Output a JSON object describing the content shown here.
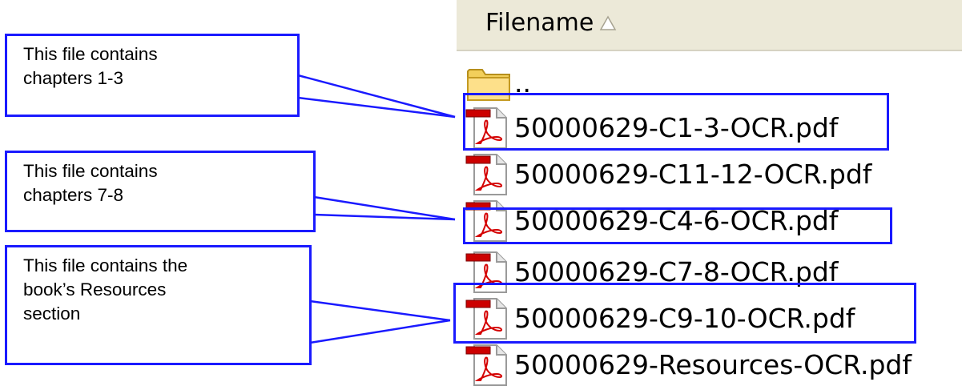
{
  "header": {
    "column_label": "Filename",
    "sort_icon": "sort-up-triangle-icon"
  },
  "parent_entry": {
    "label": "..",
    "icon": "folder-icon"
  },
  "files": [
    {
      "name": "50000629-C1-3-OCR.pdf",
      "icon": "pdf-file-icon"
    },
    {
      "name": "50000629-C11-12-OCR.pdf",
      "icon": "pdf-file-icon"
    },
    {
      "name": "50000629-C4-6-OCR.pdf",
      "icon": "pdf-file-icon"
    },
    {
      "name": "50000629-C7-8-OCR.pdf",
      "icon": "pdf-file-icon"
    },
    {
      "name": "50000629-C9-10-OCR.pdf",
      "icon": "pdf-file-icon"
    },
    {
      "name": "50000629-Resources-OCR.pdf",
      "icon": "pdf-file-icon"
    }
  ],
  "callouts": [
    {
      "lines": [
        "This file contains",
        "chapters 1-3"
      ]
    },
    {
      "lines": [
        "This file contains",
        "chapters 7-8"
      ]
    },
    {
      "lines": [
        "This file contains the",
        "book’s Resources",
        "section"
      ]
    }
  ],
  "colors": {
    "annotation_blue": "#1a1aff",
    "header_bg": "#ece9d8",
    "pdf_red": "#cc0000"
  }
}
